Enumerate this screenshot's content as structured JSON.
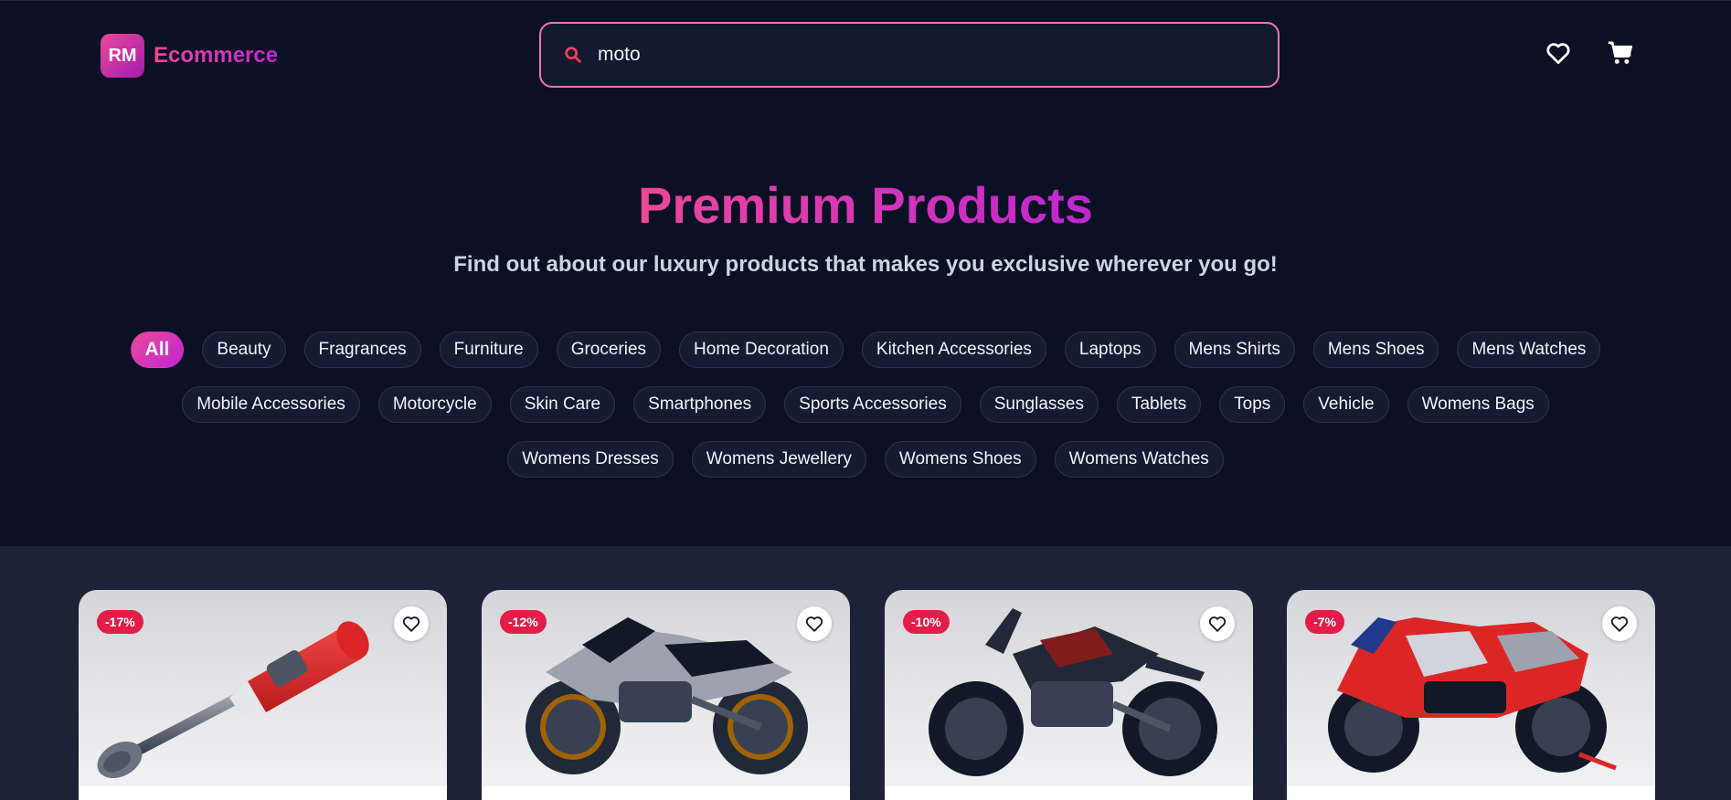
{
  "header": {
    "logo_badge": "RM",
    "logo_text": "Ecommerce",
    "search_value": "moto"
  },
  "hero": {
    "title": "Premium Products",
    "subtitle": "Find out about our luxury products that makes you exclusive wherever you go!"
  },
  "categories": [
    "All",
    "Beauty",
    "Fragrances",
    "Furniture",
    "Groceries",
    "Home Decoration",
    "Kitchen Accessories",
    "Laptops",
    "Mens Shirts",
    "Mens Shoes",
    "Mens Watches",
    "Mobile Accessories",
    "Motorcycle",
    "Skin Care",
    "Smartphones",
    "Sports Accessories",
    "Sunglasses",
    "Tablets",
    "Tops",
    "Vehicle",
    "Womens Bags",
    "Womens Dresses",
    "Womens Jewellery",
    "Womens Shoes",
    "Womens Watches"
  ],
  "active_category": "All",
  "products": [
    {
      "discount": "-17%",
      "image": "hand-blender-image"
    },
    {
      "discount": "-12%",
      "image": "sport-motorcycle-image"
    },
    {
      "discount": "-10%",
      "image": "naked-motorcycle-image"
    },
    {
      "discount": "-7%",
      "image": "racing-motorcycle-image"
    }
  ],
  "colors": {
    "accent": "#ec4899",
    "accent_2": "#c026d3",
    "background": "#0b1024",
    "product_section": "#1a2338",
    "badge": "#e11d48"
  }
}
